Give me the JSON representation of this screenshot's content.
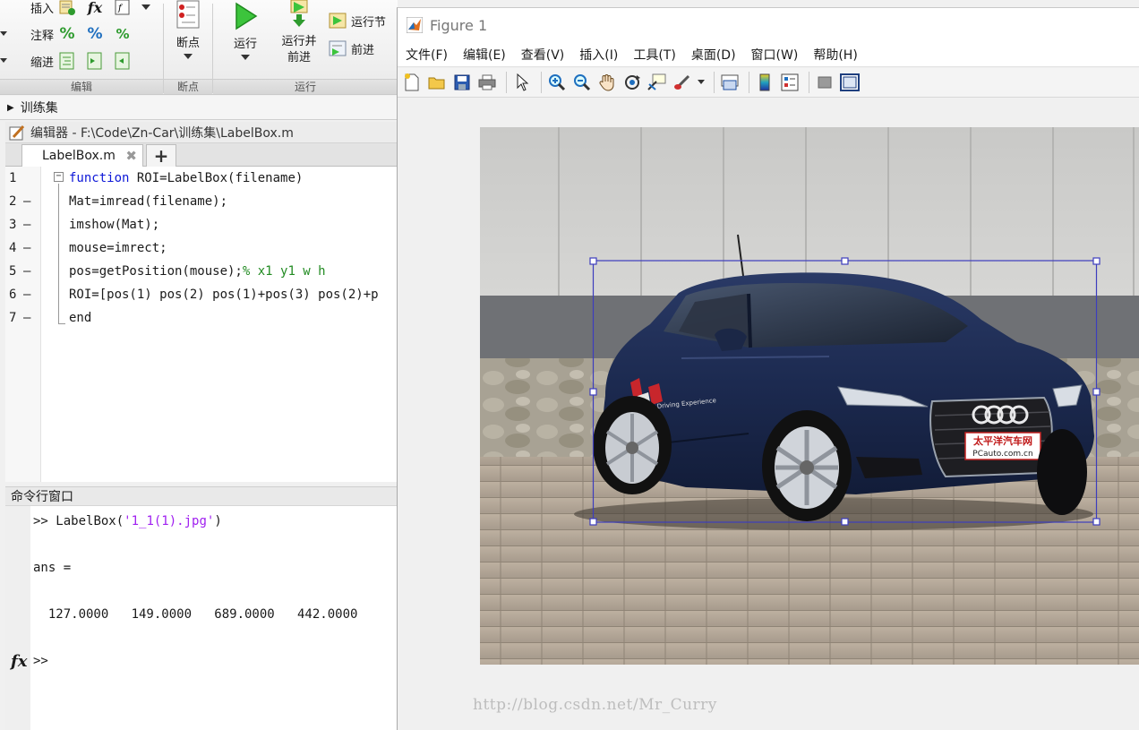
{
  "toolstrip": {
    "rows": [
      {
        "label": "插入"
      },
      {
        "label": "注释"
      },
      {
        "label": "缩进"
      }
    ],
    "groups": {
      "edit": "编辑",
      "breakpoints": "断点",
      "run": "运行"
    },
    "breakpoints_button": "断点",
    "run_button": "运行",
    "run_advance_button_line1": "运行并",
    "run_advance_button_line2": "前进",
    "run_section_button": "运行节",
    "advance_button": "前进"
  },
  "folder": {
    "name": "训练集"
  },
  "editor": {
    "title": "编辑器 - F:\\Code\\Zn-Car\\训练集\\LabelBox.m",
    "tab_label": "LabelBox.m",
    "lines": [
      {
        "num": "1",
        "dash": "",
        "keyword": "function",
        "code": " ROI=LabelBox(filename)",
        "comment": ""
      },
      {
        "num": "2",
        "dash": "—",
        "keyword": "",
        "code": "Mat=imread(filename);",
        "comment": ""
      },
      {
        "num": "3",
        "dash": "—",
        "keyword": "",
        "code": "imshow(Mat);",
        "comment": ""
      },
      {
        "num": "4",
        "dash": "—",
        "keyword": "",
        "code": "mouse=imrect;",
        "comment": ""
      },
      {
        "num": "5",
        "dash": "—",
        "keyword": "",
        "code": "pos=getPosition(mouse);",
        "comment": "% x1 y1 w h"
      },
      {
        "num": "6",
        "dash": "—",
        "keyword": "",
        "code": "ROI=[pos(1) pos(2) pos(1)+pos(3) pos(2)+p",
        "comment": ""
      },
      {
        "num": "7",
        "dash": "—",
        "keyword": "end",
        "code": "",
        "comment": ""
      }
    ]
  },
  "command_window": {
    "title": "命令行窗口",
    "prompt": ">> ",
    "call_fn": "LabelBox(",
    "call_arg": "'1_1(1).jpg'",
    "call_close": ")",
    "ans_label": "ans =",
    "ans_values": "  127.0000   149.0000   689.0000   442.0000",
    "fx_symbol": "fx",
    "empty_prompt": ">>"
  },
  "figure": {
    "title": "Figure 1",
    "menu": [
      "文件(F)",
      "编辑(E)",
      "查看(V)",
      "插入(I)",
      "工具(T)",
      "桌面(D)",
      "窗口(W)",
      "帮助(H)"
    ],
    "badge_line1": "太平洋汽车网",
    "badge_line2": "PCauto.com.cn",
    "door_text": "Driving Experience",
    "watermark": "http://blog.csdn.net/Mr_Curry"
  },
  "colors": {
    "keyword": "#0e18d8",
    "comment": "#228b22",
    "string": "#a020f0",
    "roi_box": "#3d3dbd"
  }
}
